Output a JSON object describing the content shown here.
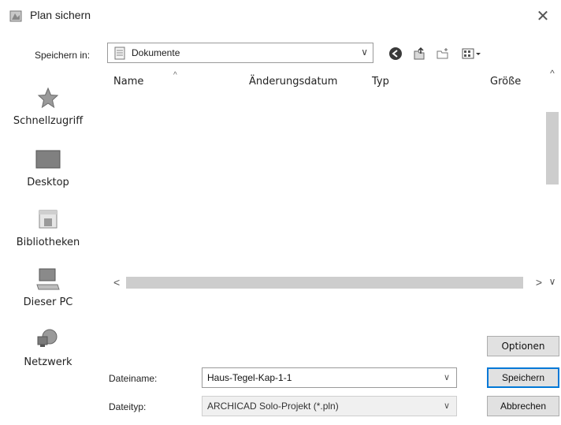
{
  "window": {
    "title": "Plan sichern",
    "close_glyph": "✕"
  },
  "save_in": {
    "label": "Speichern in:",
    "value": "Dokumente",
    "chevron": "∨"
  },
  "toolbar": {
    "icons": [
      "back-icon",
      "up-folder-icon",
      "new-folder-icon",
      "view-menu-icon"
    ]
  },
  "places": [
    {
      "label": "Schnellzugriff",
      "icon": "star-icon"
    },
    {
      "label": "Desktop",
      "icon": "desktop-icon"
    },
    {
      "label": "Bibliotheken",
      "icon": "libraries-icon"
    },
    {
      "label": "Dieser PC",
      "icon": "computer-icon"
    },
    {
      "label": "Netzwerk",
      "icon": "network-icon"
    }
  ],
  "file_list": {
    "columns": [
      "Name",
      "Änderungsdatum",
      "Typ",
      "Größe"
    ],
    "sort_caret": "^",
    "rows": []
  },
  "scroll": {
    "up": "^",
    "down": "∨",
    "left": "<",
    "right": ">"
  },
  "filename": {
    "label": "Dateiname:",
    "value": "Haus-Tegel-Kap-1-1",
    "chevron": "∨"
  },
  "filetype": {
    "label": "Dateityp:",
    "value": "ARCHICAD Solo-Projekt (*.pln)",
    "chevron": "∨"
  },
  "buttons": {
    "options": "Optionen",
    "save": "Speichern",
    "cancel": "Abbrechen"
  },
  "colors": {
    "accent": "#0078d7",
    "button_bg": "#e1e1e1",
    "scroll_thumb": "#cdcdcd"
  }
}
